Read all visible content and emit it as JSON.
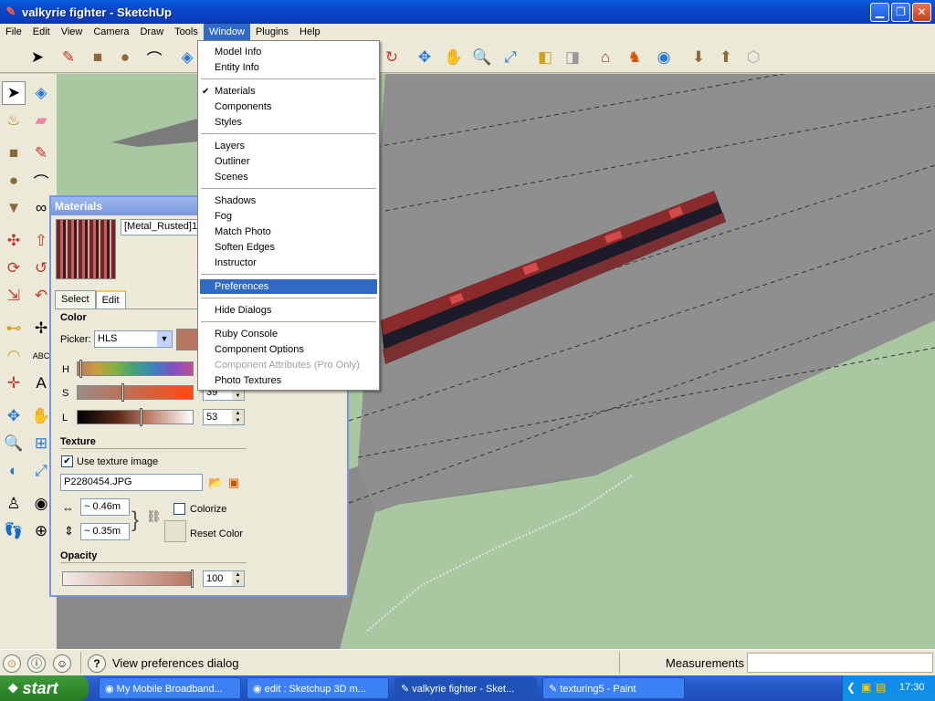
{
  "window": {
    "title": "valkyrie fighter - SketchUp",
    "icon": "sketchup-icon",
    "min_icon": "minimize-icon",
    "max_icon": "restore-icon",
    "close_icon": "close-icon"
  },
  "menubar": {
    "items": [
      "File",
      "Edit",
      "View",
      "Camera",
      "Draw",
      "Tools",
      "Window",
      "Plugins",
      "Help"
    ],
    "active": "Window"
  },
  "window_menu": {
    "items": [
      {
        "label": "Model Info"
      },
      {
        "label": "Entity Info"
      },
      {
        "label": "Materials",
        "checked": true
      },
      {
        "label": "Components"
      },
      {
        "label": "Styles"
      },
      {
        "label": "Layers"
      },
      {
        "label": "Outliner"
      },
      {
        "label": "Scenes"
      },
      {
        "label": "Shadows"
      },
      {
        "label": "Fog"
      },
      {
        "label": "Match Photo"
      },
      {
        "label": "Soften Edges"
      },
      {
        "label": "Instructor"
      },
      {
        "label": "Preferences",
        "highlighted": true
      },
      {
        "label": "Hide Dialogs"
      },
      {
        "label": "Ruby Console"
      },
      {
        "label": "Component Options"
      },
      {
        "label": "Component Attributes (Pro Only)",
        "disabled": true
      },
      {
        "label": "Photo Textures"
      }
    ],
    "check_mark": "✔"
  },
  "materials": {
    "title": "Materials",
    "material_name": "[Metal_Rusted]1",
    "tabs": [
      "Select",
      "Edit"
    ],
    "active_tab": "Edit",
    "color_label": "Color",
    "picker_label": "Picker:",
    "picker_value": "HLS",
    "h_label": "H",
    "s_label": "S",
    "l_label": "L",
    "s_value": "39",
    "l_value": "53",
    "texture_label": "Texture",
    "use_texture_label": "Use texture image",
    "use_texture_checked": true,
    "texture_file": "P2280454.JPG",
    "width_value": "~ 0.46m",
    "height_value": "~ 0.35m",
    "colorize_label": "Colorize",
    "reset_color_label": "Reset Color",
    "opacity_label": "Opacity",
    "opacity_value": "100",
    "color_hex": "#b87762"
  },
  "statusbar": {
    "text": "View preferences dialog",
    "measurements_label": "Measurements"
  },
  "taskbar": {
    "start_label": "start",
    "tasks": [
      {
        "label": "My Mobile Broadband..."
      },
      {
        "label": "edit : Sketchup 3D m..."
      },
      {
        "label": "valkyrie fighter - Sket...",
        "active": true
      },
      {
        "label": "texturing5 - Paint"
      }
    ],
    "clock": "17:30"
  },
  "colors": {
    "accent": "#316ac5",
    "titlebar": "#0b45c6",
    "ground": "#a9c8a1",
    "surface": "#8c8c8c"
  }
}
